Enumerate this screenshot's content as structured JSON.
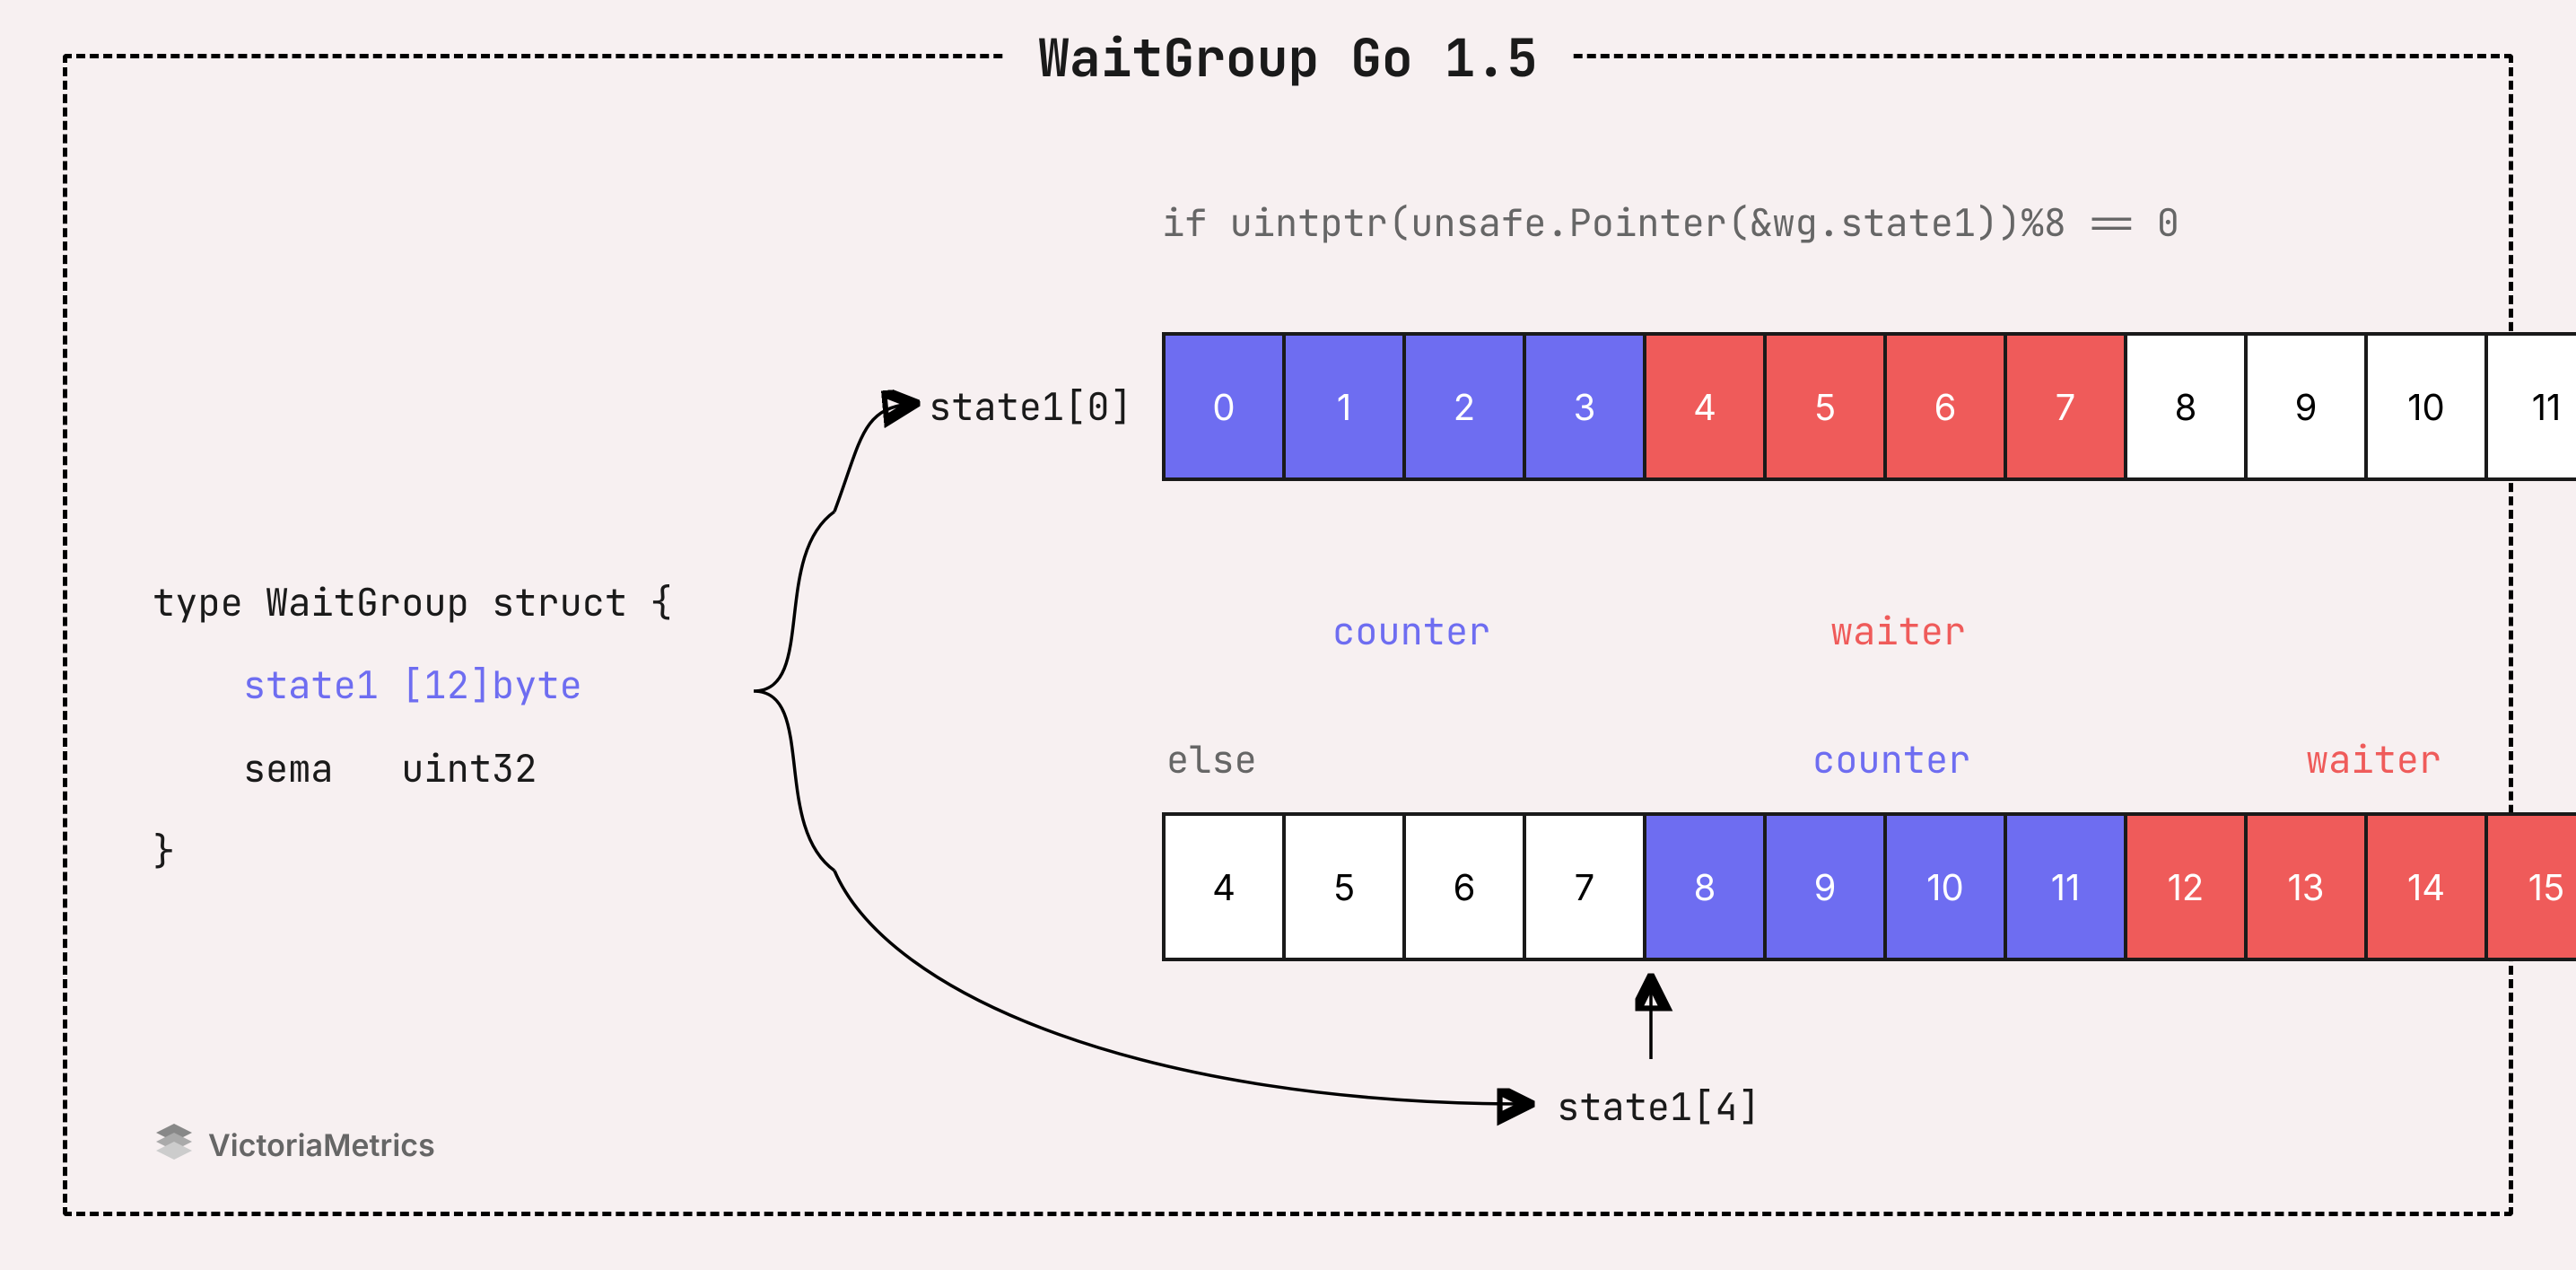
{
  "title": "WaitGroup Go 1.5",
  "struct": {
    "line1": "type WaitGroup struct {",
    "field1": "state1 [12]byte",
    "field2": "sema   uint32",
    "close": "}"
  },
  "condition": "if uintptr(unsafe.Pointer(&wg.state1))%8 == 0",
  "else_label": "else",
  "ptr_top": "state1[0]",
  "ptr_bot": "state1[4]",
  "counter_label": "counter",
  "waiter_label": "waiter",
  "colors": {
    "counter": "#6e6df1",
    "waiter": "#ef5b5a",
    "background": "#f7f0f1"
  },
  "top_bytes": [
    {
      "v": "0",
      "c": "blue"
    },
    {
      "v": "1",
      "c": "blue"
    },
    {
      "v": "2",
      "c": "blue"
    },
    {
      "v": "3",
      "c": "blue"
    },
    {
      "v": "4",
      "c": "red"
    },
    {
      "v": "5",
      "c": "red"
    },
    {
      "v": "6",
      "c": "red"
    },
    {
      "v": "7",
      "c": "red"
    },
    {
      "v": "8",
      "c": "white"
    },
    {
      "v": "9",
      "c": "white"
    },
    {
      "v": "10",
      "c": "white"
    },
    {
      "v": "11",
      "c": "white"
    }
  ],
  "bot_bytes": [
    {
      "v": "4",
      "c": "white"
    },
    {
      "v": "5",
      "c": "white"
    },
    {
      "v": "6",
      "c": "white"
    },
    {
      "v": "7",
      "c": "white"
    },
    {
      "v": "8",
      "c": "blue"
    },
    {
      "v": "9",
      "c": "blue"
    },
    {
      "v": "10",
      "c": "blue"
    },
    {
      "v": "11",
      "c": "blue"
    },
    {
      "v": "12",
      "c": "red"
    },
    {
      "v": "13",
      "c": "red"
    },
    {
      "v": "14",
      "c": "red"
    },
    {
      "v": "15",
      "c": "red"
    }
  ],
  "logo_text": "VictoriaMetrics"
}
